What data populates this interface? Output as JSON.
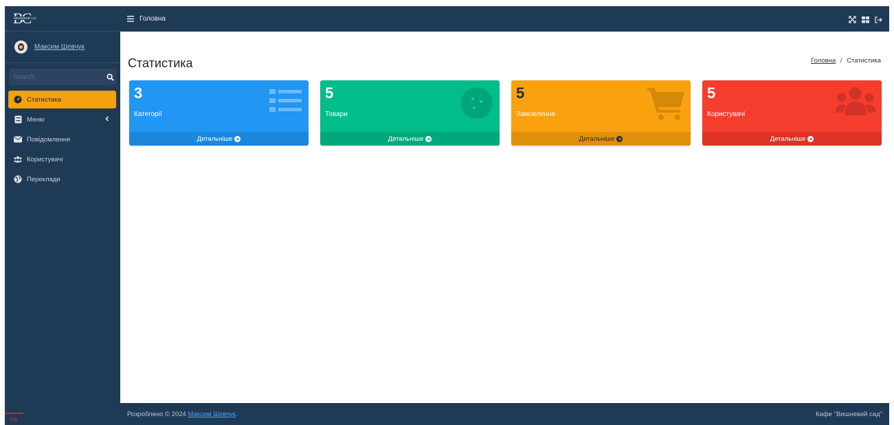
{
  "brand": {
    "logo_text": "BC",
    "logo_subtext": "ВИШНЕВИЙ САД"
  },
  "user": {
    "name": "Максим Шевчук"
  },
  "search": {
    "placeholder": "Search"
  },
  "sidebar": {
    "items": [
      {
        "label": "Статистика",
        "icon": "tachometer-icon",
        "active": true
      },
      {
        "label": "Меню",
        "icon": "list-box-icon",
        "has_chevron": true
      },
      {
        "label": "Повідомлення",
        "icon": "envelope-icon"
      },
      {
        "label": "Користувачі",
        "icon": "users-icon"
      },
      {
        "label": "Переклади",
        "icon": "globe-icon"
      }
    ],
    "badge_text": "ВФ"
  },
  "topbar": {
    "title": "Головна",
    "right_icons": [
      "fullscreen-icon",
      "grid-icon",
      "logout-icon"
    ]
  },
  "page": {
    "title": "Статистика"
  },
  "breadcrumb": {
    "home": "Головна",
    "separator": "/",
    "current": "Статистика"
  },
  "cards": [
    {
      "value": "3",
      "label": "Категорії",
      "footer": "Детальніше",
      "color": "#2196f3",
      "footer_color": "#1a87dc",
      "icon": "list-icon"
    },
    {
      "value": "5",
      "label": "Товари",
      "footer": "Детальніше",
      "color": "#00bd8b",
      "footer_color": "#00a97c",
      "icon": "cookie-icon"
    },
    {
      "value": "5",
      "label": "Замовлення",
      "footer": "Детальніше",
      "color": "#f9a10e",
      "footer_color": "#e08f0a",
      "icon": "cart-icon"
    },
    {
      "value": "5",
      "label": "Користувачі",
      "footer": "Детальніше",
      "color": "#f53d2e",
      "footer_color": "#dd3225",
      "icon": "users-icon"
    }
  ],
  "footer": {
    "prefix": "Розроблено © 2024",
    "author": "Максим Шевчук",
    "suffix": ".",
    "right": "Кафе \"Вишневий сад\""
  }
}
